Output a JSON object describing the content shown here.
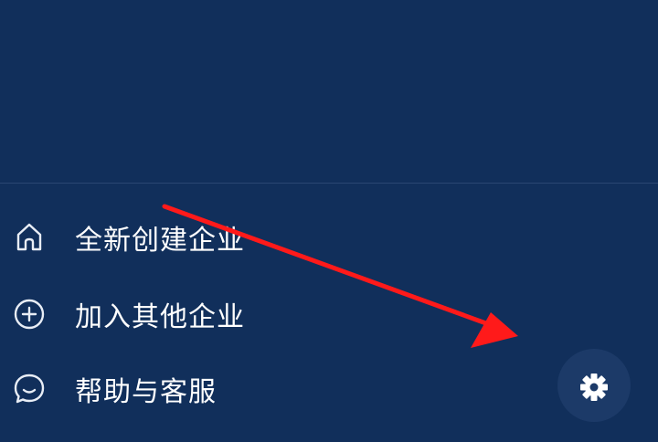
{
  "menu": {
    "items": [
      {
        "label": "全新创建企业",
        "icon": "home-icon"
      },
      {
        "label": "加入其他企业",
        "icon": "plus-circle-icon"
      },
      {
        "label": "帮助与客服",
        "icon": "chat-bubble-icon"
      }
    ]
  },
  "settings_button": {
    "icon": "gear-icon"
  },
  "annotation": {
    "type": "red-arrow",
    "color": "#ff1a1a"
  },
  "colors": {
    "background": "#112f5b",
    "divider": "#2a4672",
    "text": "#ffffff",
    "icon_stroke": "#e8edf5"
  }
}
